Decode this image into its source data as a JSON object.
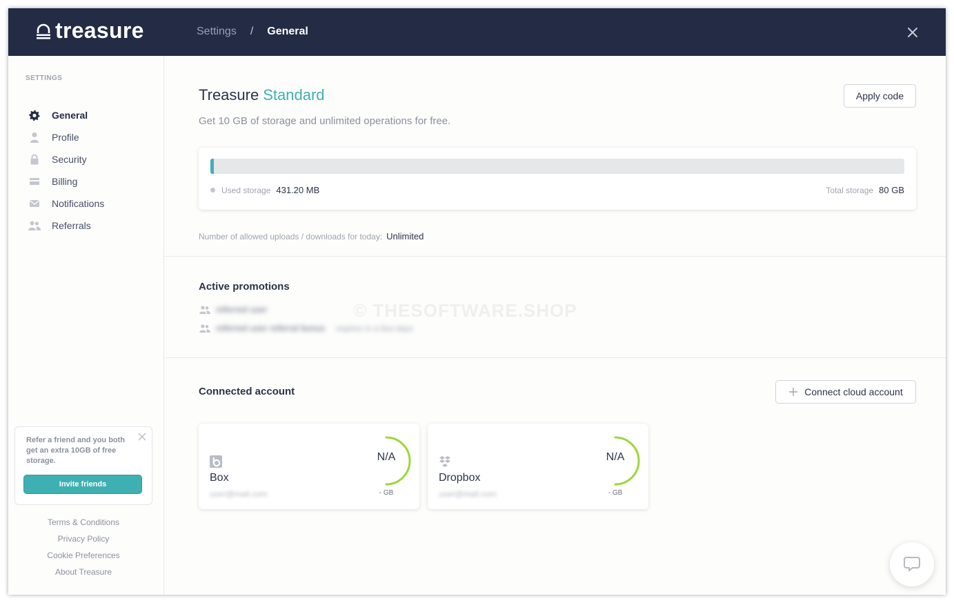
{
  "app": {
    "logo_text": "treasure",
    "breadcrumb": {
      "parent": "Settings",
      "separator": "/",
      "current": "General"
    }
  },
  "sidebar": {
    "heading": "SETTINGS",
    "items": [
      {
        "label": "General",
        "icon": "gear-icon",
        "active": true
      },
      {
        "label": "Profile",
        "icon": "user-icon",
        "active": false
      },
      {
        "label": "Security",
        "icon": "lock-icon",
        "active": false
      },
      {
        "label": "Billing",
        "icon": "card-icon",
        "active": false
      },
      {
        "label": "Notifications",
        "icon": "mail-icon",
        "active": false
      },
      {
        "label": "Referrals",
        "icon": "users-icon",
        "active": false
      }
    ],
    "refer_card": {
      "text": "Refer a friend and you both get an extra 10GB of free storage.",
      "button": "Invite friends"
    },
    "footer_links": [
      "Terms & Conditions",
      "Privacy Policy",
      "Cookie Preferences",
      "About Treasure"
    ]
  },
  "plan": {
    "name": "Treasure",
    "tier": "Standard",
    "subtitle": "Get 10 GB of storage and unlimited operations for free.",
    "apply_code_label": "Apply code"
  },
  "storage": {
    "used_label": "Used storage",
    "used_value": "431.20 MB",
    "total_label": "Total storage",
    "total_value": "80 GB",
    "used_fraction": 0.005
  },
  "uploads": {
    "label": "Number of allowed uploads / downloads for today:",
    "value": "Unlimited"
  },
  "promotions": {
    "title": "Active promotions",
    "items": [
      {
        "text": "referred user",
        "detail": ""
      },
      {
        "text": "referred user referral bonus",
        "detail": "expires in a few days"
      }
    ],
    "watermark": "© THESOFTWARE.SHOP"
  },
  "connected": {
    "title": "Connected account",
    "connect_button": "Connect cloud account",
    "accounts": [
      {
        "name": "Box",
        "email": "user@mail.com",
        "usage": "N/A",
        "unit": "- GB",
        "icon": "box-icon"
      },
      {
        "name": "Dropbox",
        "email": "user@mail.com",
        "usage": "N/A",
        "unit": "- GB",
        "icon": "dropbox-icon"
      }
    ]
  },
  "colors": {
    "header_bg": "#232b45",
    "accent": "#3fb0b2",
    "gauge": "#9bd83a"
  }
}
